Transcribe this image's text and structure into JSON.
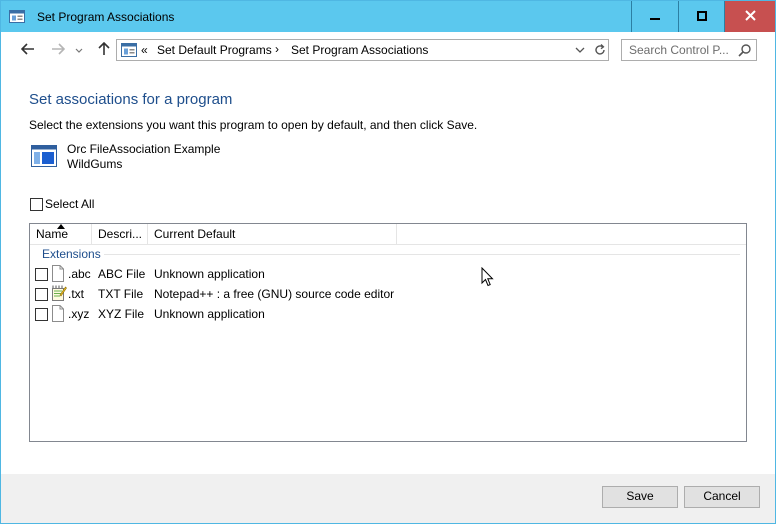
{
  "window": {
    "title": "Set Program Associations",
    "title_bar_color": "#5bc8ee",
    "close_color": "#c75050"
  },
  "navigation": {
    "back_icon": "arrow-left-icon",
    "forward_icon": "arrow-right-icon",
    "recent_icon": "chevron-down-icon",
    "up_icon": "arrow-up-icon",
    "address_chevrons": "«",
    "breadcrumbs": [
      "Set Default Programs",
      "Set Program Associations"
    ],
    "breadcrumb_separator": "›",
    "search_placeholder": "Search Control P..."
  },
  "content": {
    "heading": "Set associations for a program",
    "instructions": "Select the extensions you want this program to open by default, and then click Save.",
    "program_name": "Orc FileAssociation Example",
    "program_company": "WildGums",
    "select_all_label": "Select All",
    "heading_color": "#1e4e8c"
  },
  "list": {
    "columns": [
      "Name",
      "Descri...",
      "Current Default"
    ],
    "group_label": "Extensions",
    "rows": [
      {
        "extension": ".abc",
        "description": "ABC File",
        "current_default": "Unknown application",
        "icon": "blank-file-icon",
        "checked": false
      },
      {
        "extension": ".txt",
        "description": "TXT File",
        "current_default": "Notepad++ : a free (GNU) source code editor",
        "icon": "notepad-plus-plus-icon",
        "checked": false
      },
      {
        "extension": ".xyz",
        "description": "XYZ File",
        "current_default": "Unknown application",
        "icon": "blank-file-icon",
        "checked": false
      }
    ]
  },
  "footer": {
    "save_label": "Save",
    "cancel_label": "Cancel"
  }
}
